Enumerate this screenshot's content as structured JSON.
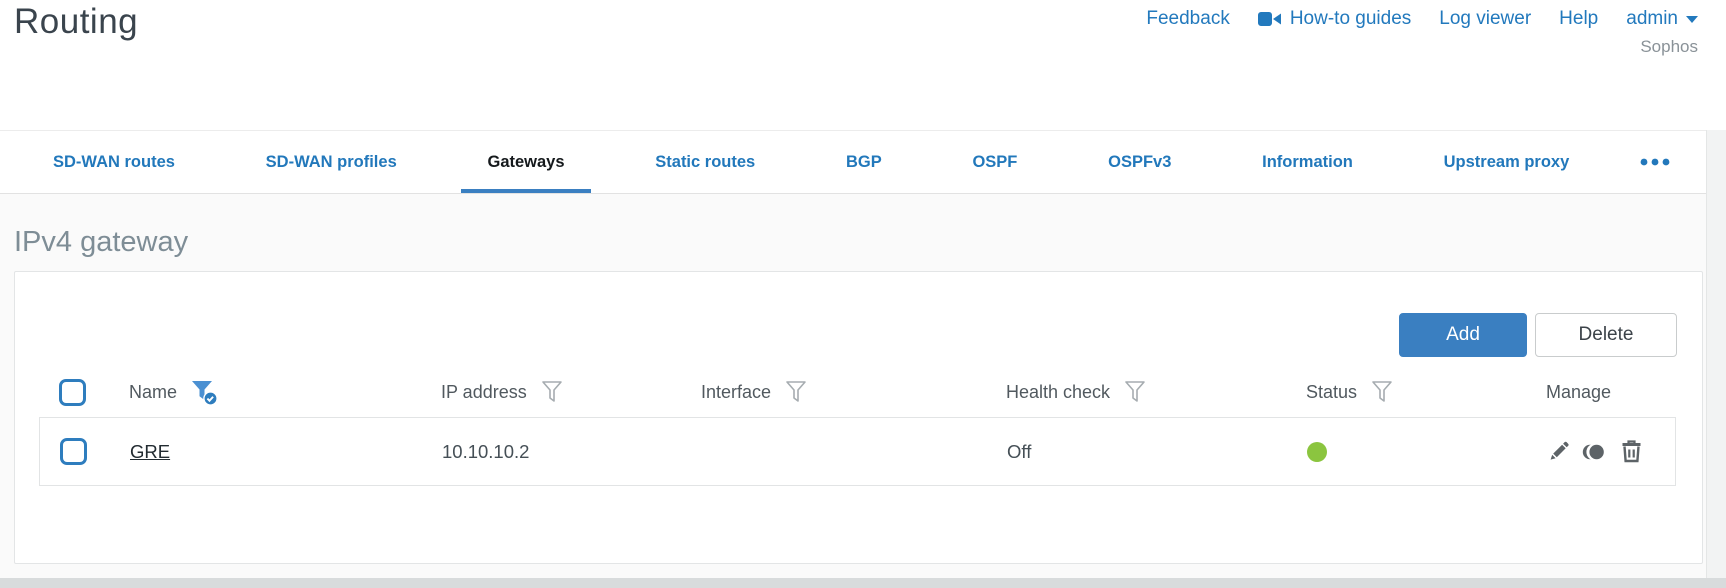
{
  "header": {
    "title": "Routing",
    "brand": "Sophos",
    "links": [
      {
        "label": "Feedback"
      },
      {
        "label": "How-to guides",
        "icon": "video-camera-icon"
      },
      {
        "label": "Log viewer"
      },
      {
        "label": "Help"
      },
      {
        "label": "admin",
        "icon": "caret-down-icon"
      }
    ]
  },
  "tabs": [
    {
      "label": "SD-WAN routes",
      "active": false
    },
    {
      "label": "SD-WAN profiles",
      "active": false
    },
    {
      "label": "Gateways",
      "active": true
    },
    {
      "label": "Static routes",
      "active": false
    },
    {
      "label": "BGP",
      "active": false
    },
    {
      "label": "OSPF",
      "active": false
    },
    {
      "label": "OSPFv3",
      "active": false
    },
    {
      "label": "Information",
      "active": false
    },
    {
      "label": "Upstream proxy",
      "active": false
    }
  ],
  "section": {
    "heading": "IPv4 gateway"
  },
  "toolbar": {
    "add_label": "Add",
    "delete_label": "Delete"
  },
  "table": {
    "columns": [
      {
        "label": "Name",
        "filter": "active"
      },
      {
        "label": "IP address",
        "filter": "inactive"
      },
      {
        "label": "Interface",
        "filter": "inactive"
      },
      {
        "label": "Health check",
        "filter": "inactive"
      },
      {
        "label": "Status",
        "filter": "inactive"
      },
      {
        "label": "Manage",
        "filter": "none"
      }
    ],
    "rows": [
      {
        "name": "GRE",
        "ip_address": "10.10.10.2",
        "interface": "",
        "health_check": "Off",
        "status": "green",
        "status_color": "#8bc53f"
      }
    ]
  },
  "colors": {
    "accent_blue": "#2e7dbe",
    "link_blue": "#2279bd",
    "active_tab_underline": "#3a7fc1",
    "status_green": "#8bc53f"
  }
}
